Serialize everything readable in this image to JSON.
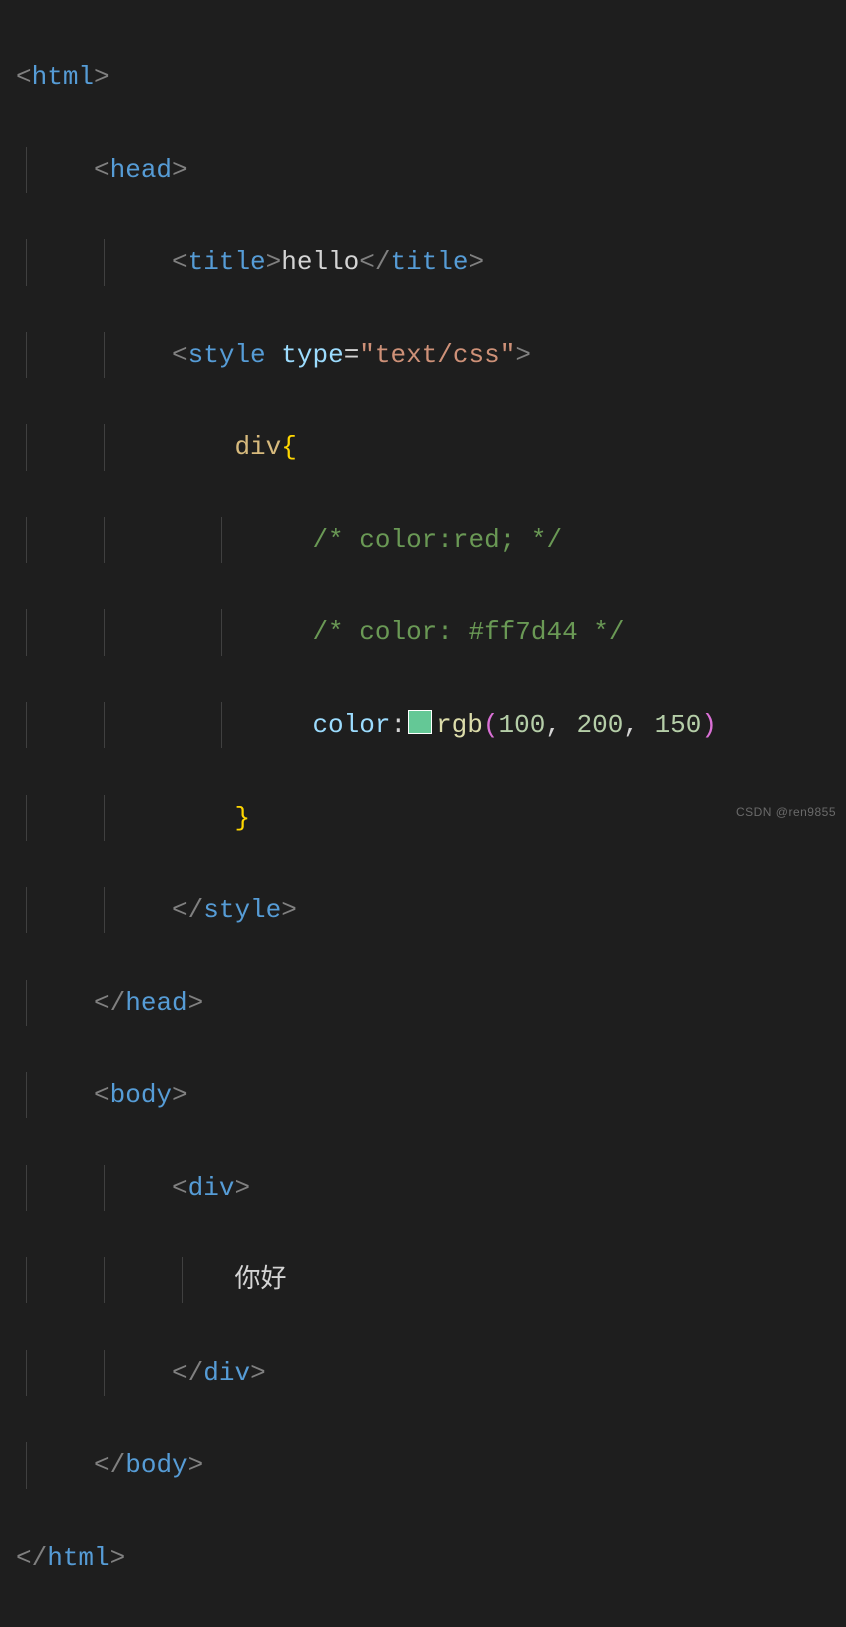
{
  "tags": {
    "html": "html",
    "head": "head",
    "title": "title",
    "style": "style",
    "body": "body",
    "div": "div"
  },
  "attr": {
    "type_name": "type",
    "type_eq": "=",
    "type_val": "\"text/css\""
  },
  "css": {
    "selector": "div",
    "open_brace": "{",
    "close_brace": "}",
    "comment1": "/* color:red; */",
    "comment2": "/* color: #ff7d44 */",
    "prop": "color",
    "colon": ":",
    "func": "rgb",
    "lp": "(",
    "rp": ")",
    "n1": "100",
    "n2": "200",
    "n3": "150",
    "comma": ",",
    "swatch_color": "#64c896"
  },
  "content": {
    "title_text": "hello",
    "div_text": "你好"
  },
  "watermark": "CSDN @ren9855"
}
